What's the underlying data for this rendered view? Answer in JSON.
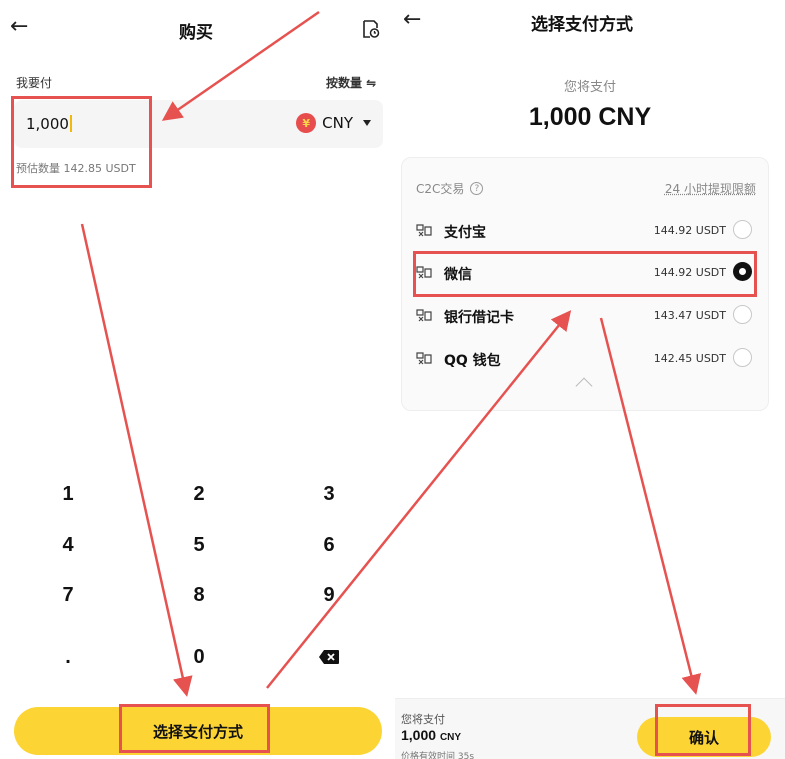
{
  "left": {
    "title": "购买",
    "pay_label": "我要付",
    "by_quantity": "按数量 ⇋",
    "amount": "1,000",
    "currency": "CNY",
    "currency_symbol": "¥",
    "estimate": "预估数量 142.85 USDT",
    "keys": [
      "1",
      "2",
      "3",
      "4",
      "5",
      "6",
      "7",
      "8",
      "9",
      ".",
      "0"
    ],
    "cta_label": "选择支付方式"
  },
  "right": {
    "title": "选择支付方式",
    "pay_label": "您将支付",
    "pay_amount": "1,000 CNY",
    "section_label": "C2C交易",
    "limit_link": "24 小时提现限额",
    "methods": [
      {
        "name": "支付宝",
        "qty": "144.92 USDT",
        "selected": false
      },
      {
        "name": "微信",
        "qty": "144.92 USDT",
        "selected": true
      },
      {
        "name": "银行借记卡",
        "qty": "143.47 USDT",
        "selected": false
      },
      {
        "name": "QQ 钱包",
        "qty": "142.45 USDT",
        "selected": false
      }
    ],
    "footer": {
      "label": "您将支付",
      "amount": "1,000",
      "unit": "CNY",
      "timer": "价格有效时间 35s"
    },
    "confirm_label": "确认"
  },
  "colors": {
    "accent_yellow": "#fcd535",
    "annotation_red": "#e65250"
  },
  "icons": [
    "back-arrow-icon",
    "order-history-icon",
    "yuan-coin-icon",
    "dropdown-caret-icon",
    "help-icon",
    "payment-method-icon",
    "backspace-icon",
    "chevron-up-icon"
  ]
}
